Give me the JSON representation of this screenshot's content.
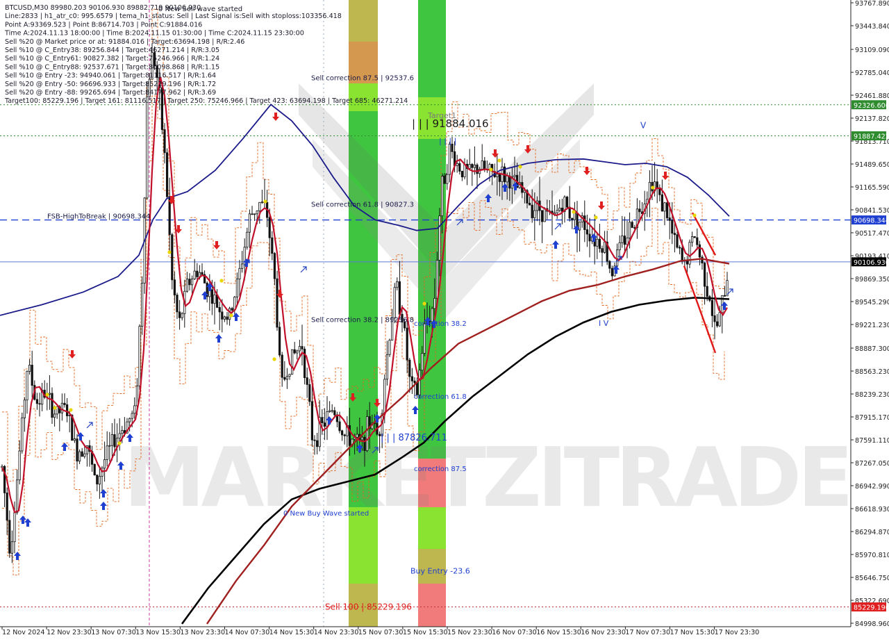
{
  "header": {
    "lines": [
      "BTCUSD,M30  89980.203 90106.930 89882.719 90106.930",
      "Line:2833 | h1_atr_c0: 995.6579 | tema_h1_status: Sell | Last Signal is:Sell with stoploss:103356.418",
      "Point A:93369.523 | Point B:86714.703 | Point C:91884.016",
      "Time A:2024.11.13 18:00:00 | Time B:2024.11.15 01:30:00 | Time C:2024.11.15 23:30:00",
      "Sell %20 @ Market price or at: 91884.016 | Target:63694.198 | R/R:2.46",
      "Sell %10 @ C_Entry38: 89256.844 | Target:46271.214 | R/R:3.05",
      "Sell %10 @ C_Entry61: 90827.382 | Target:75246.966 | R/R:1.24",
      "Sell %10 @ C_Entry88: 92537.671 | Target:80098.868 | R/R:1.15",
      "Sell %10 @ Entry -23: 94940.061 | Target:81116.517 | R/R:1.64",
      "Sell %20 @ Entry -50: 96696.933 | Target:85229.196 | R/R:1.72",
      "Sell %20 @ Entry -88: 99265.694 | Target:84177.962 | R/R:3.69",
      "Target100: 85229.196 | Target 161: 81116.517 | Target 250: 75246.966 | Target 423: 63694.198 | Target 685: 46271.214"
    ],
    "wave_title": "0 New Sell wave started"
  },
  "watermark": "MARKETZITRADE",
  "chart_data": {
    "type": "candlestick",
    "symbol": "BTCUSD",
    "timeframe": "M30",
    "ylim": [
      84998.96,
      93767.89
    ],
    "y_ticks": [
      "93767.890",
      "93443.840",
      "93109.090",
      "92785.040",
      "92461.880",
      "92137.820",
      "91813.710",
      "91489.650",
      "91165.590",
      "90841.530",
      "90517.470",
      "90193.410",
      "89869.350",
      "89545.290",
      "89221.230",
      "88887.300",
      "88563.230",
      "88239.230",
      "87915.170",
      "87591.110",
      "87267.050",
      "86942.990",
      "86618.930",
      "86294.870",
      "85970.810",
      "85646.750",
      "85322.690",
      "84998.960"
    ],
    "x_labels": [
      "12 Nov 2024",
      "12 Nov 23:30",
      "13 Nov 07:30",
      "13 Nov 15:30",
      "13 Nov 23:30",
      "14 Nov 07:30",
      "14 Nov 15:30",
      "14 Nov 23:30",
      "15 Nov 07:30",
      "15 Nov 15:30",
      "15 Nov 23:30",
      "16 Nov 07:30",
      "16 Nov 15:30",
      "16 Nov 23:30",
      "17 Nov 07:30",
      "17 Nov 15:30",
      "17 Nov 23:30"
    ],
    "price_boxes": [
      {
        "value": "92326.606",
        "price": 92326.606,
        "color": "#2e8b2e"
      },
      {
        "value": "91887.422",
        "price": 91887.422,
        "color": "#2e8b2e"
      },
      {
        "value": "90698.344",
        "price": 90698.344,
        "color": "#1f3fd1"
      },
      {
        "value": "90106.930",
        "price": 90106.93,
        "color": "#000000"
      },
      {
        "value": "85229.196",
        "price": 85229.196,
        "color": "#e02020"
      }
    ],
    "hlines": [
      {
        "price": 92326.606,
        "color": "#2e8b2e",
        "style": "dotted"
      },
      {
        "price": 91887.422,
        "color": "#2e8b2e",
        "style": "dotted"
      },
      {
        "price": 90698.344,
        "color": "#1f3fd1",
        "style": "dashed"
      },
      {
        "price": 90106.93,
        "color": "#5a7ad8",
        "style": "solid"
      },
      {
        "price": 85229.196,
        "color": "#c03030",
        "style": "dotted"
      }
    ],
    "annotations": [
      {
        "text": "FSB-HighToBreak | 90698.344",
        "price": 90698.344,
        "color": "#1a1a4a"
      },
      {
        "text": "Sell correction 87.5 | 92537.6",
        "price": 92537.6,
        "color": "#1a1a4a"
      },
      {
        "text": "Sell correction 61.8 | 90827.3",
        "price": 90827.3,
        "color": "#1a1a4a"
      },
      {
        "text": "Sell correction 38.2 | 89256.8",
        "price": 89256.8,
        "color": "#1a1a4a"
      },
      {
        "text": "Sell 100 | 85229.196",
        "price": 85229.196,
        "color": "#e02020"
      },
      {
        "text": "correction 38.2",
        "price": 89221.0,
        "color": "#1f3fd1"
      },
      {
        "text": "correction 61.8",
        "price": 88190.0,
        "color": "#1f3fd1"
      },
      {
        "text": "correction 87.5",
        "price": 87130.0,
        "color": "#1f3fd1"
      },
      {
        "text": "Buy Entry -23.6",
        "price": 85720.0,
        "color": "#1f3fd1"
      },
      {
        "text": "0 New Buy Wave started",
        "price": 86500.0,
        "color": "#1f3fd1"
      },
      {
        "text": "| | | 91884.016",
        "price": 91990.0,
        "color": "#1a1a1a"
      },
      {
        "text": "| | | 87826.711",
        "price": 87600.0,
        "color": "#1f3fd1"
      },
      {
        "text": "Target1",
        "price": 92120.0,
        "color": "#7a7a7a"
      },
      {
        "text": "| | | |",
        "price": 91760.0,
        "color": "#1f3fd1"
      },
      {
        "text": "V",
        "price": 91200.0,
        "color": "#1a1a1a"
      },
      {
        "text": "V",
        "price": 91700.0,
        "color": "#1f3fd1"
      },
      {
        "text": "I V",
        "price": 89180.0,
        "color": "#1f3fd1"
      }
    ],
    "colors": {
      "candle": "#111111",
      "ma_red": "#c0102a",
      "ma_darkred": "#a02020",
      "ma_black": "#000000",
      "ma_blue": "#1a1a8a",
      "zone_green": "#30c030",
      "zone_lime": "#80e020",
      "zone_olive": "#b8b040",
      "zone_orange": "#d09040",
      "zone_pink": "#f07070",
      "buy_arrow": "#1f3fd1",
      "sell_arrow": "#e02020",
      "signal_star": "#e8d800"
    }
  }
}
